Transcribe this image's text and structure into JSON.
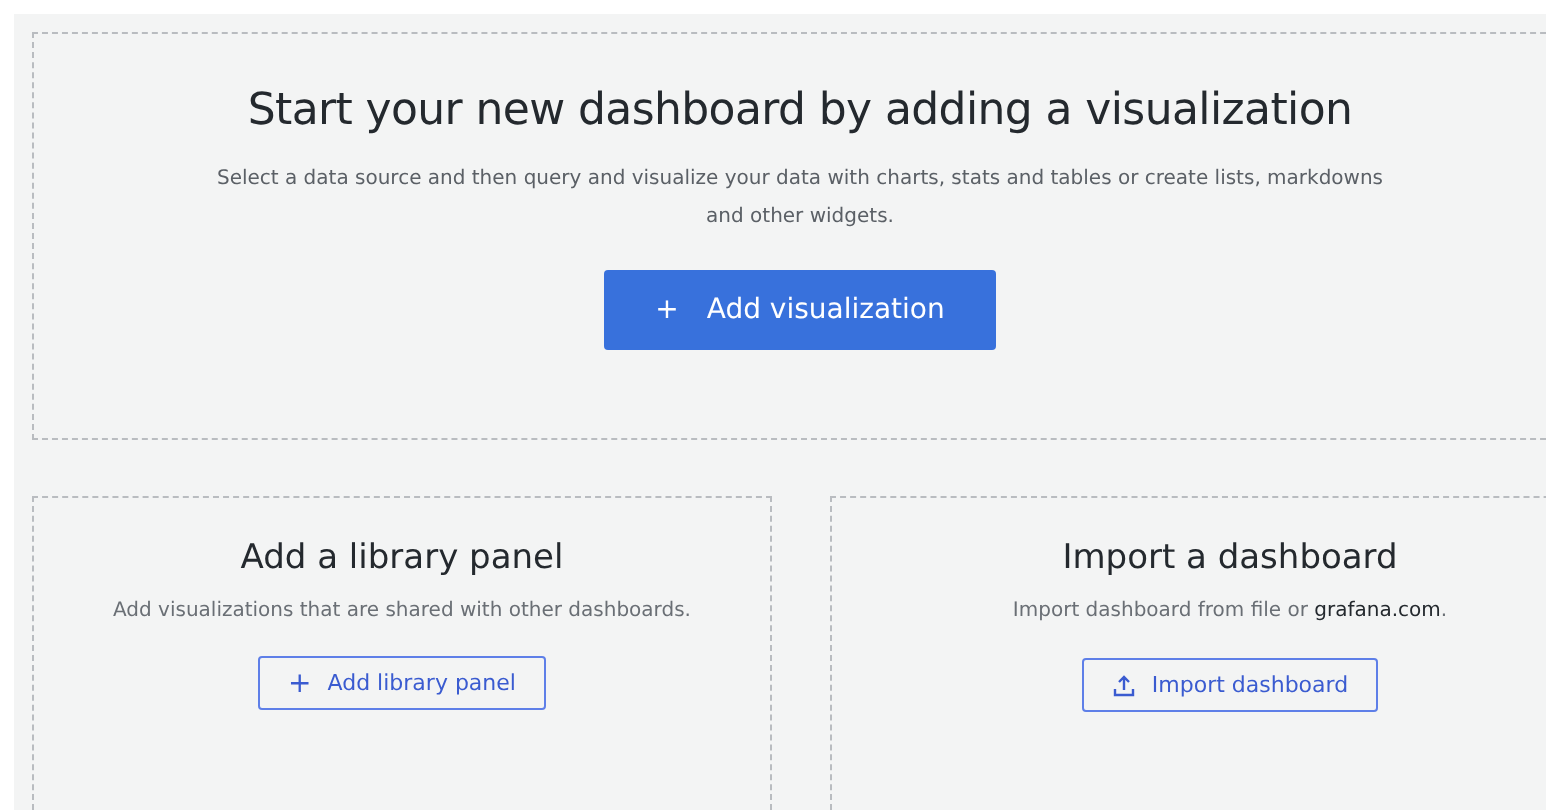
{
  "hero": {
    "title": "Start your new dashboard by adding a visualization",
    "description": "Select a data source and then query and visualize your data with charts, stats and tables or create lists, markdowns and other widgets.",
    "button": {
      "icon": "+",
      "label": "Add visualization"
    }
  },
  "cards": [
    {
      "kind": "library",
      "title": "Add a library panel",
      "description": "Add visualizations that are shared with other dashboards.",
      "button": {
        "icon": "+",
        "label": "Add library panel"
      }
    },
    {
      "kind": "import",
      "title": "Import a dashboard",
      "description": "Import dashboard from file or ",
      "link": "grafana.com",
      "trail": ".",
      "button": {
        "label": "Import dashboard"
      }
    }
  ]
}
